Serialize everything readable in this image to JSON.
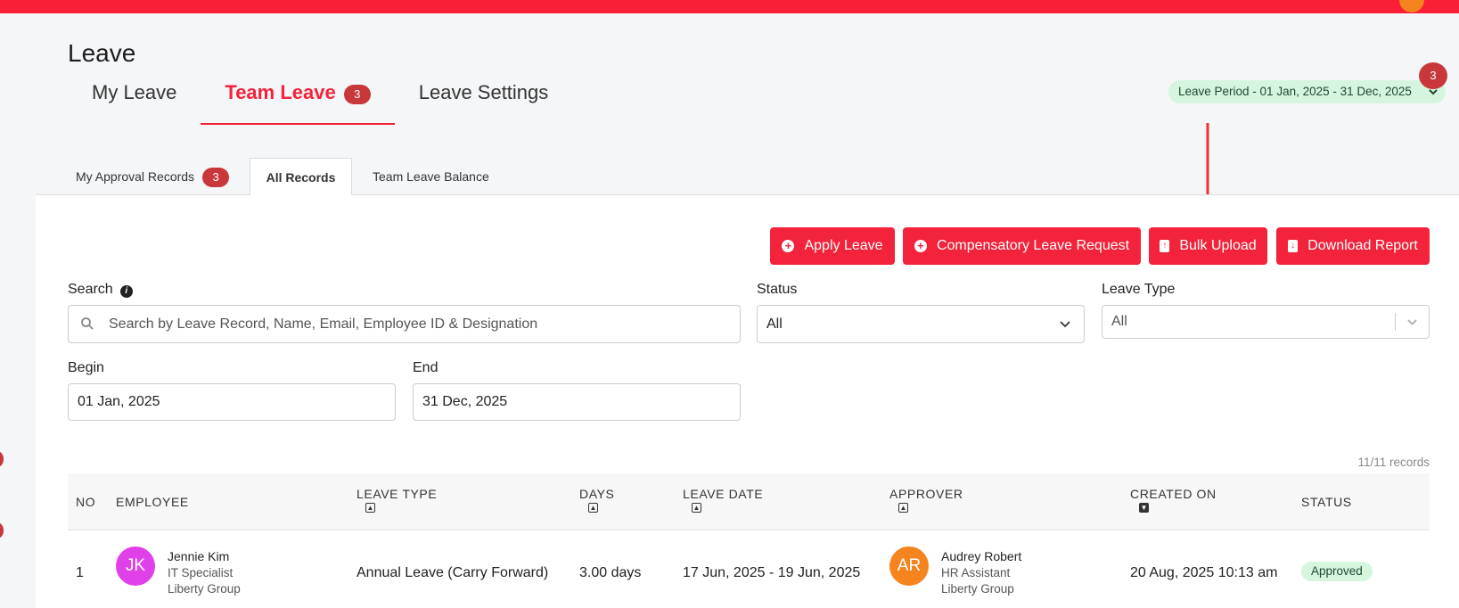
{
  "header": {
    "page_title": "Leave",
    "main_tabs": [
      {
        "label": "My Leave"
      },
      {
        "label": "Team Leave",
        "badge": "3"
      },
      {
        "label": "Leave Settings"
      }
    ],
    "leave_period": "Leave Period - 01 Jan, 2025 - 31 Dec, 2025",
    "notification_badge": "3"
  },
  "subtabs": [
    {
      "label": "My Approval Records",
      "badge": "3"
    },
    {
      "label": "All Records"
    },
    {
      "label": "Team Leave Balance"
    }
  ],
  "actions": {
    "apply_leave": "Apply Leave",
    "compensatory": "Compensatory Leave Request",
    "bulk_upload": "Bulk Upload",
    "download_report": "Download Report"
  },
  "filters": {
    "search_label": "Search",
    "search_placeholder": "Search by Leave Record, Name, Email, Employee ID & Designation",
    "status_label": "Status",
    "status_value": "All",
    "leave_type_label": "Leave Type",
    "leave_type_value": "All",
    "begin_label": "Begin",
    "begin_value": "01 Jan, 2025",
    "end_label": "End",
    "end_value": "31 Dec, 2025"
  },
  "table": {
    "records_count": "11/11 records",
    "columns": [
      "NO",
      "EMPLOYEE",
      "LEAVE TYPE",
      "DAYS",
      "LEAVE DATE",
      "APPROVER",
      "CREATED ON",
      "STATUS"
    ],
    "rows": [
      {
        "no": "1",
        "employee": {
          "initials": "JK",
          "name": "Jennie Kim",
          "title": "IT Specialist",
          "company": "Liberty Group"
        },
        "leave_type": "Annual Leave (Carry Forward)",
        "days": "3.00 days",
        "leave_date": "17 Jun, 2025 - 19 Jun, 2025",
        "approver": {
          "initials": "AR",
          "name": "Audrey Robert",
          "title": "HR Assistant",
          "company": "Liberty Group"
        },
        "created_on": "20 Aug, 2025 10:13 am",
        "status": "Approved"
      }
    ]
  },
  "colors": {
    "brand_red": "#f2233a",
    "badge_red": "#c8383a",
    "approved_bg": "#d6f5df",
    "jk_avatar": "#e040e8",
    "ar_avatar": "#f5841f"
  },
  "icons": [
    "search-icon",
    "info-icon",
    "plus-circle-icon",
    "file-upload-icon",
    "file-download-icon",
    "chevron-down-icon",
    "sort-icon"
  ]
}
